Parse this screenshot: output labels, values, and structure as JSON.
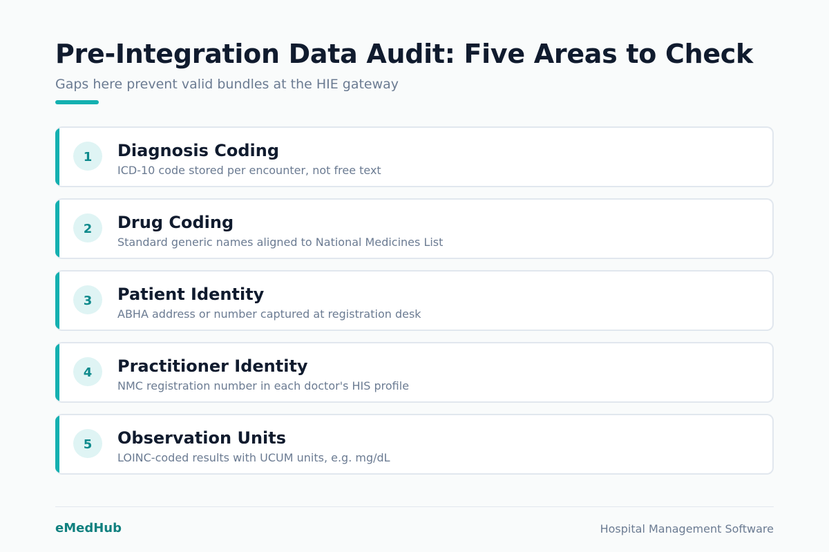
{
  "header": {
    "title": "Pre-Integration Data Audit: Five Areas to Check",
    "subtitle": "Gaps here prevent valid bundles at the HIE gateway"
  },
  "items": [
    {
      "number": "1",
      "title": "Diagnosis Coding",
      "description": "ICD-10 code stored per encounter, not free text"
    },
    {
      "number": "2",
      "title": "Drug Coding",
      "description": "Standard generic names aligned to National Medicines List"
    },
    {
      "number": "3",
      "title": "Patient Identity",
      "description": "ABHA address or number captured at registration desk"
    },
    {
      "number": "4",
      "title": "Practitioner Identity",
      "description": "NMC registration number in each doctor's HIS profile"
    },
    {
      "number": "5",
      "title": "Observation Units",
      "description": "LOINC-coded results with UCUM units, e.g. mg/dL"
    }
  ],
  "footer": {
    "brand": "eMedHub",
    "tagline": "Hospital Management Software"
  },
  "colors": {
    "accent": "#14b0b0",
    "badge_bg": "#dff4f4",
    "badge_text": "#0e8a8c",
    "title_text": "#101b2e",
    "muted_text": "#6b7b92",
    "brand": "#10807f"
  }
}
